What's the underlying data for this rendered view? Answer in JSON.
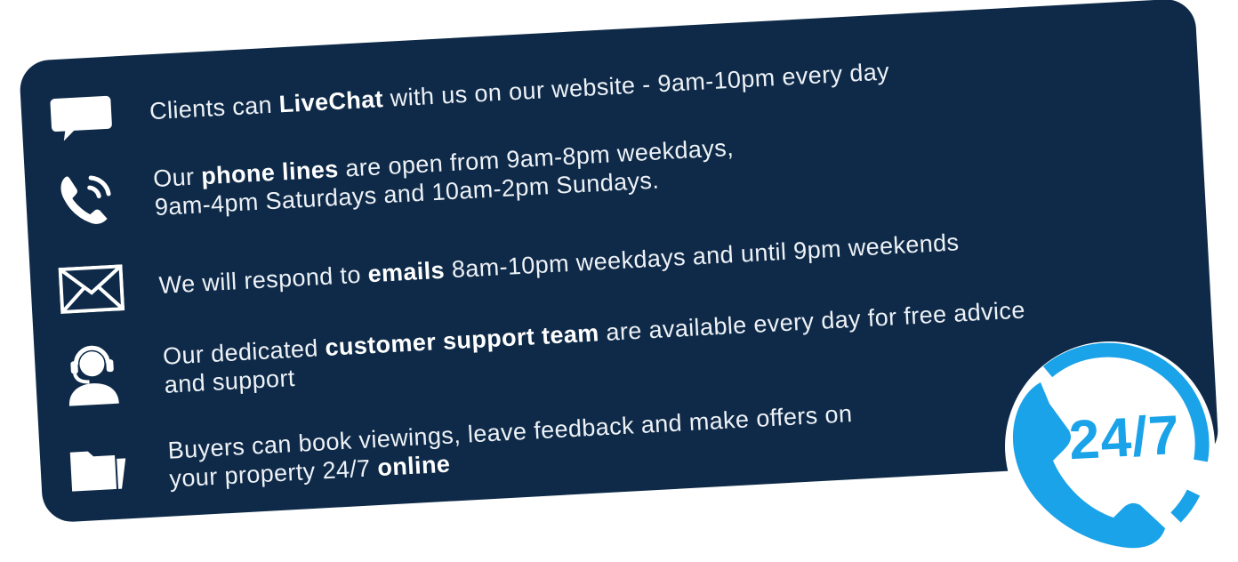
{
  "features": [
    {
      "icon": "chat-bubble-icon",
      "lines": [
        [
          "Clients can ",
          "LiveChat",
          " with us on our website - 9am-10pm every day"
        ]
      ]
    },
    {
      "icon": "phone-ringing-icon",
      "lines": [
        [
          "Our ",
          "phone lines",
          " are open from 9am-8pm weekdays,"
        ],
        [
          "9am-4pm Saturdays and 10am-2pm Sundays.",
          "",
          ""
        ]
      ]
    },
    {
      "icon": "envelope-icon",
      "lines": [
        [
          "We will respond to ",
          "emails",
          " 8am-10pm weekdays and until 9pm weekends"
        ]
      ]
    },
    {
      "icon": "headset-agent-icon",
      "lines": [
        [
          "Our dedicated ",
          "customer support team",
          " are available every day for free advice"
        ],
        [
          "and support",
          "",
          ""
        ]
      ]
    },
    {
      "icon": "folder-icon",
      "lines": [
        [
          "Buyers can book viewings, leave feedback and make offers on",
          "",
          ""
        ],
        [
          "your property 24/7 ",
          "online",
          ""
        ]
      ]
    }
  ],
  "badge": {
    "text": "24/7",
    "icon": "phone-circle-badge-icon"
  },
  "colors": {
    "card": "#0e2a48",
    "text": "#ffffff",
    "accent": "#1aa3e8"
  }
}
